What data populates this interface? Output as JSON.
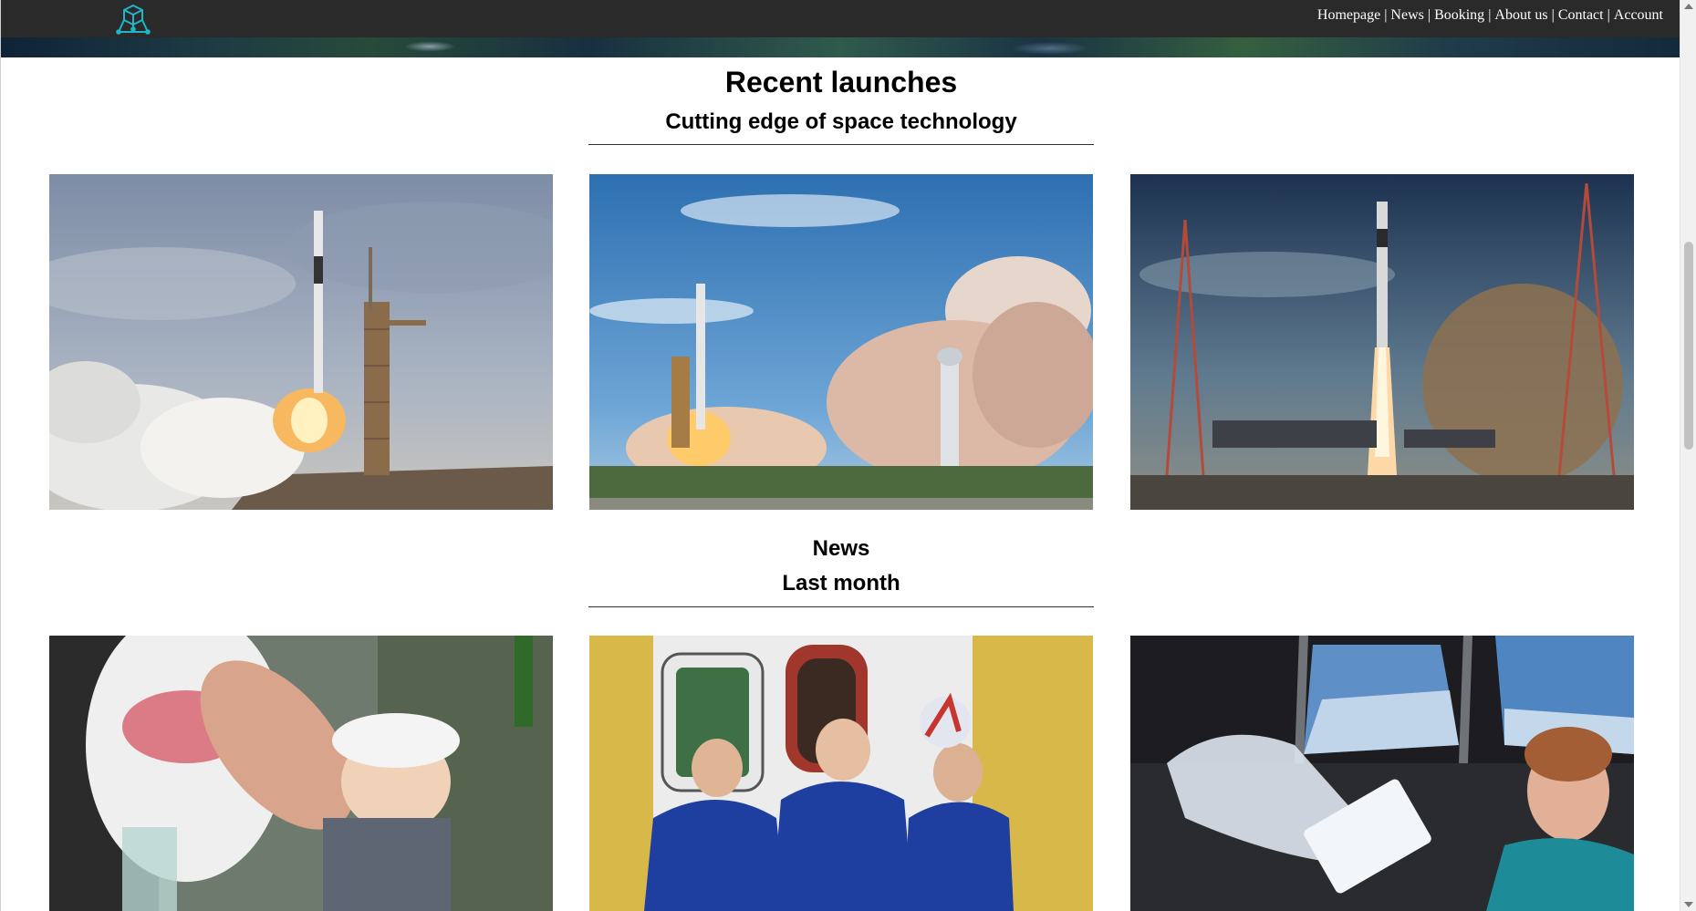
{
  "header": {
    "logo_icon": "cube-network-icon",
    "nav": [
      {
        "label": "Homepage"
      },
      {
        "label": "News"
      },
      {
        "label": "Booking"
      },
      {
        "label": "About us"
      },
      {
        "label": "Contact"
      },
      {
        "label": "Account"
      }
    ],
    "separator": "|"
  },
  "launches": {
    "title": "Recent launches",
    "subtitle": "Cutting edge of space technology",
    "photos": [
      {
        "description": "rocket-launch-cloudy-sky"
      },
      {
        "description": "rocket-launch-blue-sky-smoke"
      },
      {
        "description": "rocket-launch-dusk-towers"
      }
    ]
  },
  "news": {
    "title": "News",
    "subtitle": "Last month",
    "photos": [
      {
        "description": "child-high-five"
      },
      {
        "description": "three-cosmonauts-blue-suits"
      },
      {
        "description": "astronaut-in-cupola"
      }
    ]
  },
  "colors": {
    "topbar": "#2a2a2a",
    "nav_text": "#ffffff",
    "logo_accent": "#1fb6c9",
    "rule": "#333333"
  }
}
